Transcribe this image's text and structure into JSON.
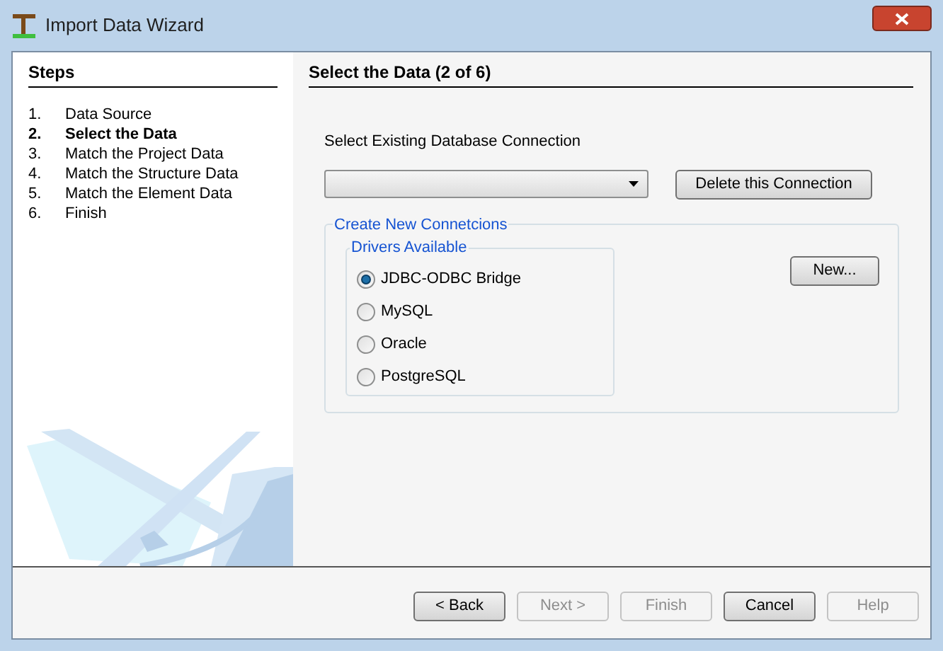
{
  "window": {
    "title": "Import Data Wizard"
  },
  "steps": {
    "heading": "Steps",
    "items": [
      {
        "number": "1.",
        "label": "Data Source",
        "selected": false
      },
      {
        "number": "2.",
        "label": "Select the Data",
        "selected": true
      },
      {
        "number": "3.",
        "label": "Match the Project Data",
        "selected": false
      },
      {
        "number": "4.",
        "label": "Match the Structure Data",
        "selected": false
      },
      {
        "number": "5.",
        "label": "Match the Element Data",
        "selected": false
      },
      {
        "number": "6.",
        "label": "Finish",
        "selected": false
      }
    ]
  },
  "page": {
    "heading": "Select the Data (2 of 6)",
    "connection_label": "Select Existing Database Connection",
    "delete_button": "Delete this Connection",
    "new_group": {
      "title": "Create New Connetcions",
      "new_button": "New...",
      "drivers": {
        "title": "Drivers Available",
        "options": [
          {
            "label": "JDBC-ODBC Bridge",
            "selected": true
          },
          {
            "label": "MySQL",
            "selected": false
          },
          {
            "label": "Oracle",
            "selected": false
          },
          {
            "label": "PostgreSQL",
            "selected": false
          }
        ]
      }
    }
  },
  "buttons": [
    {
      "label": "< Back",
      "disabled": false
    },
    {
      "label": "Next >",
      "disabled": true
    },
    {
      "label": "Finish",
      "disabled": true
    },
    {
      "label": "Cancel",
      "disabled": false
    },
    {
      "label": "Help",
      "disabled": true
    }
  ]
}
